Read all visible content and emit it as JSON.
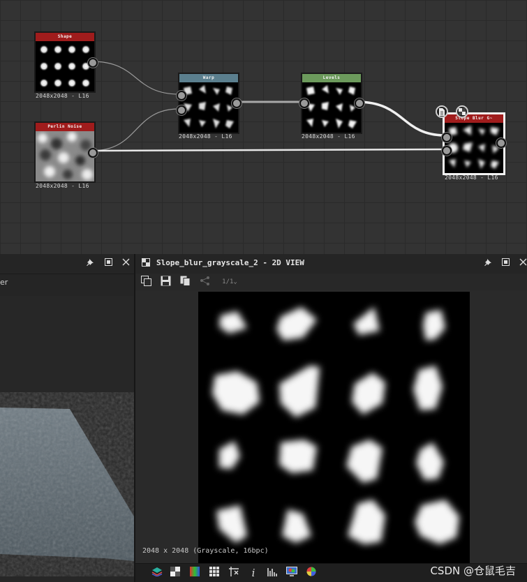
{
  "graph": {
    "nodes": {
      "shape": {
        "title": "Shape",
        "resolution": "2048x2048 - L16",
        "header_color": "#a01c1c"
      },
      "perlin": {
        "title": "Perlin Noise",
        "resolution": "2048x2048 - L16",
        "header_color": "#a01c1c"
      },
      "warp": {
        "title": "Warp",
        "resolution": "2048x2048 - L16",
        "header_color": "#5b7f8e"
      },
      "levels": {
        "title": "Levels",
        "resolution": "2048x2048 - L16",
        "header_color": "#6c9a5c"
      },
      "slope_blur": {
        "title": "Slope Blur G~",
        "resolution": "2048x2048 - L16",
        "header_color": "#a01c1c"
      }
    }
  },
  "left_panel": {
    "partial_label": "er"
  },
  "view2d": {
    "title": "Slope_blur_grayscale_2 - 2D VIEW",
    "info": "2048 x 2048 (Grayscale, 16bpc)",
    "zoom_select": "1/1"
  },
  "statusbar": {
    "watermark": "CSDN @仓鼠毛吉"
  }
}
